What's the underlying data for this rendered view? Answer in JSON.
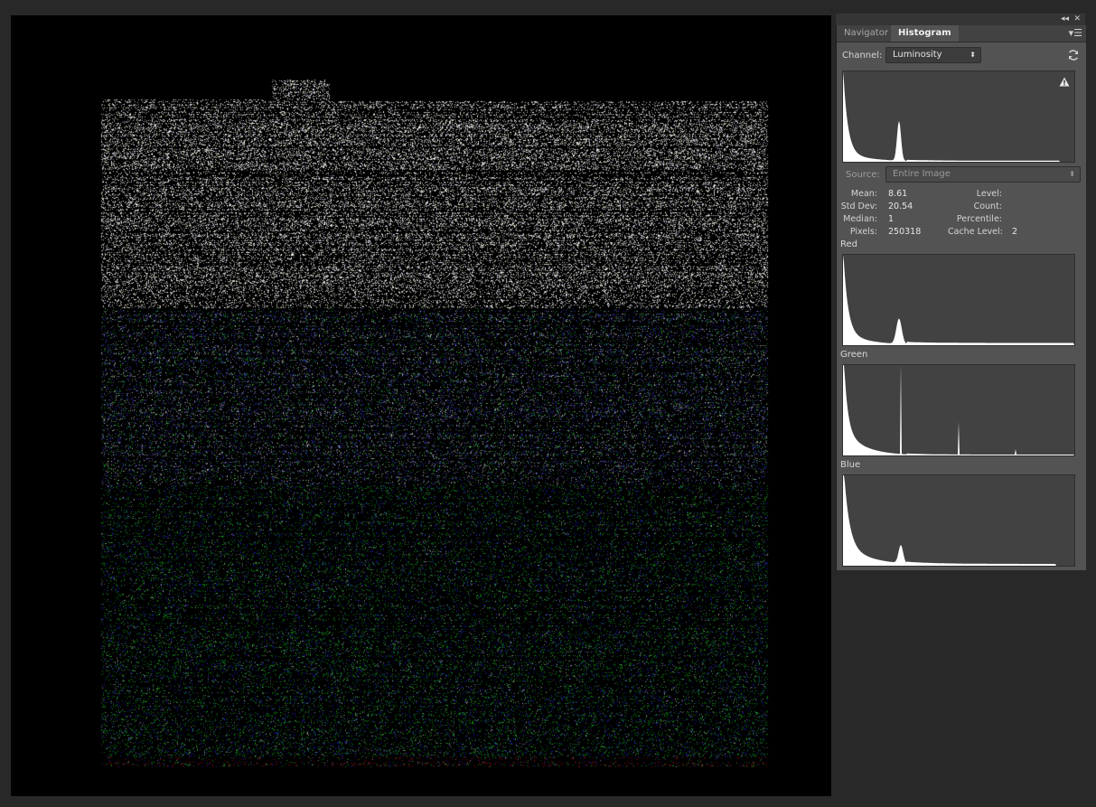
{
  "panel": {
    "tabs": [
      {
        "label": "Navigator",
        "active": false
      },
      {
        "label": "Histogram",
        "active": true
      }
    ]
  },
  "channel": {
    "label": "Channel:",
    "value": "Luminosity"
  },
  "source": {
    "label": "Source:",
    "value": "Entire Image"
  },
  "stats": {
    "mean": {
      "label": "Mean:",
      "value": "8.61"
    },
    "std_dev": {
      "label": "Std Dev:",
      "value": "20.54"
    },
    "median": {
      "label": "Median:",
      "value": "1"
    },
    "pixels": {
      "label": "Pixels:",
      "value": "250318"
    },
    "level": {
      "label": "Level:",
      "value": ""
    },
    "count": {
      "label": "Count:",
      "value": ""
    },
    "percentile": {
      "label": "Percentile:",
      "value": ""
    },
    "cache_level": {
      "label": "Cache Level:",
      "value": "2"
    }
  },
  "channels": {
    "red": "Red",
    "green": "Green",
    "blue": "Blue"
  },
  "icons": {
    "collapse": "double-chevron-left-icon",
    "close": "close-icon",
    "panel_menu": "panel-menu-icon",
    "refresh": "refresh-icon",
    "warning": "cached-data-warning-icon"
  },
  "colors": {
    "panel_bg": "#535353",
    "histogram_bg": "#424242",
    "histogram_fill": "#ffffff",
    "canvas_bg": "#000000",
    "workspace_bg": "#282828"
  }
}
